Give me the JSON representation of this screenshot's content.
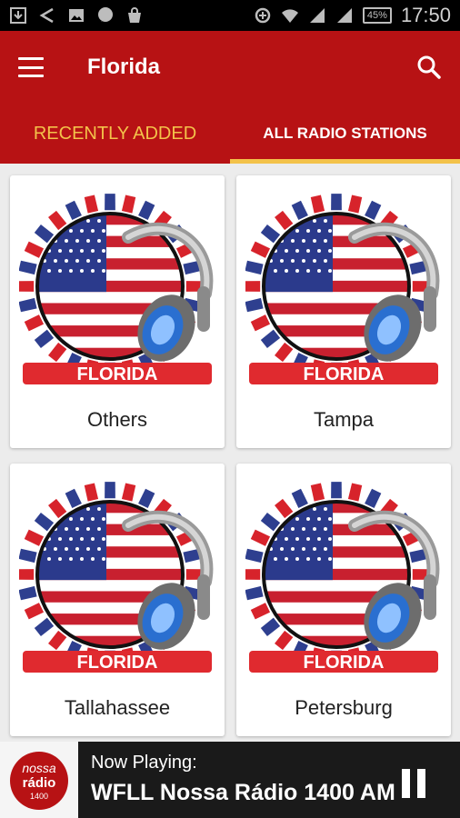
{
  "status_bar": {
    "time": "17:50",
    "battery": "45%"
  },
  "app_bar": {
    "title": "Florida"
  },
  "tabs": [
    {
      "label": "RECENTLY ADDED"
    },
    {
      "label": "ALL RADIO STATIONS"
    }
  ],
  "cards": [
    {
      "name": "Others",
      "logo_text": "FLORIDA"
    },
    {
      "name": "Tampa",
      "logo_text": "FLORIDA"
    },
    {
      "name": "Tallahassee",
      "logo_text": "FLORIDA"
    },
    {
      "name": "Petersburg",
      "logo_text": "FLORIDA"
    }
  ],
  "now_playing": {
    "label": "Now Playing:",
    "station": "WFLL Nossa Rádio 1400 AM",
    "logo_line1": "nossa",
    "logo_line2": "rádio",
    "logo_line3": "1400"
  },
  "colors": {
    "appbar": "#b71214",
    "tab_accent": "#f3c24a",
    "player_bg": "#1a1a1a"
  }
}
